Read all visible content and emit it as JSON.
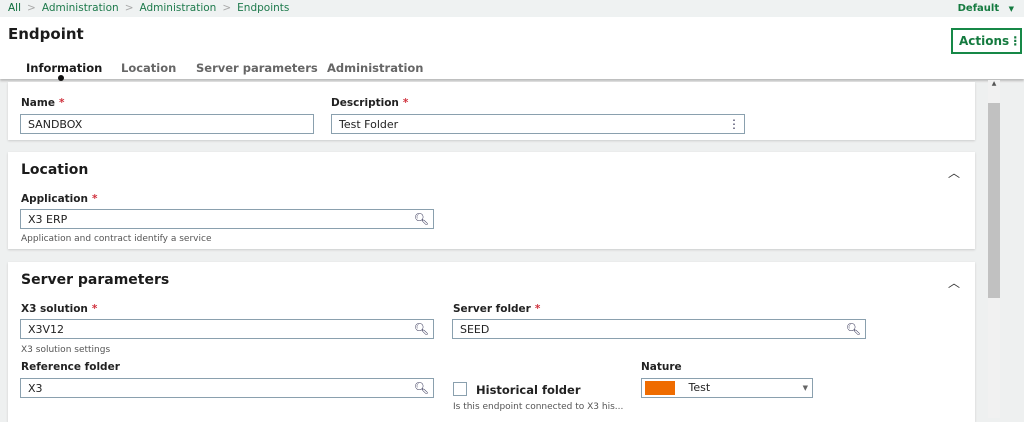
{
  "breadcrumb": [
    "All",
    "Administration",
    "Administration",
    "Endpoints"
  ],
  "profile": "Default",
  "title": "Endpoint",
  "actions_label": "Actions",
  "tabs": [
    "Information",
    "Location",
    "Server parameters",
    "Administration"
  ],
  "info": {
    "name_label": "Name",
    "name_value": "SANDBOX",
    "desc_label": "Description",
    "desc_value": "Test Folder"
  },
  "location": {
    "title": "Location",
    "app_label": "Application",
    "app_value": "X3 ERP",
    "app_help": "Application and contract identify a service"
  },
  "server": {
    "title": "Server parameters",
    "sol_label": "X3 solution",
    "sol_value": "X3V12",
    "sol_help": "X3 solution settings",
    "folder_label": "Server folder",
    "folder_value": "SEED",
    "ref_label": "Reference folder",
    "ref_value": "X3",
    "hist_label": "Historical folder",
    "hist_help": "Is this endpoint connected to X3 his...",
    "nature_label": "Nature",
    "nature_value": "Test",
    "nature_color": "#ef6c00"
  }
}
